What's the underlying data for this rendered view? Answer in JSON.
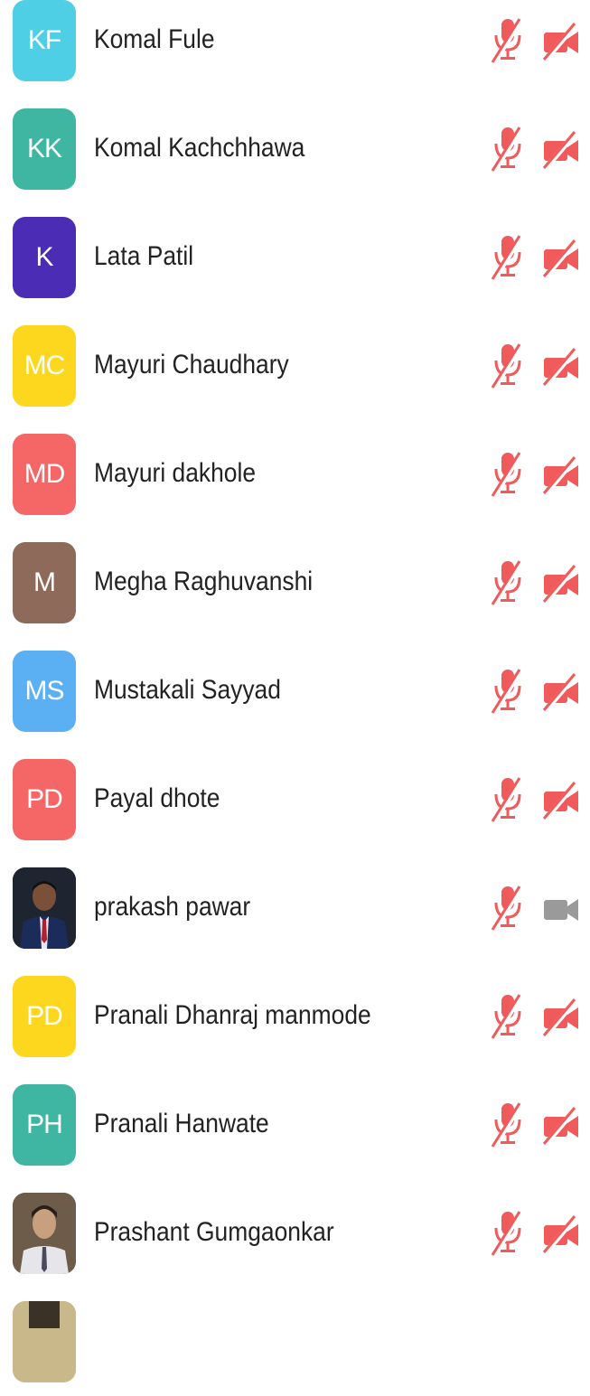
{
  "participants": [
    {
      "name": "Komal Fule",
      "initials": "KF",
      "avatar_color": "#4fcfe6",
      "avatar_type": "initials",
      "mic": "muted",
      "video": "off"
    },
    {
      "name": "Komal Kachchhawa",
      "initials": "KK",
      "avatar_color": "#3fb6a2",
      "avatar_type": "initials",
      "mic": "muted",
      "video": "off"
    },
    {
      "name": "Lata Patil",
      "initials": "K",
      "avatar_color": "#4b2cb4",
      "avatar_type": "initials",
      "mic": "muted",
      "video": "off"
    },
    {
      "name": "Mayuri Chaudhary",
      "initials": "MC",
      "avatar_color": "#fcd71e",
      "avatar_type": "initials",
      "mic": "muted",
      "video": "off"
    },
    {
      "name": "Mayuri dakhole",
      "initials": "MD",
      "avatar_color": "#f56667",
      "avatar_type": "initials",
      "mic": "muted",
      "video": "off"
    },
    {
      "name": "Megha Raghuvanshi",
      "initials": "M",
      "avatar_color": "#8d6a5a",
      "avatar_type": "initials",
      "mic": "muted",
      "video": "off"
    },
    {
      "name": "Mustakali Sayyad",
      "initials": "MS",
      "avatar_color": "#5ab0f2",
      "avatar_type": "initials",
      "mic": "muted",
      "video": "off"
    },
    {
      "name": "Payal dhote",
      "initials": "PD",
      "avatar_color": "#f56667",
      "avatar_type": "initials",
      "mic": "muted",
      "video": "off"
    },
    {
      "name": "prakash pawar",
      "initials": "",
      "avatar_color": "#2a3240",
      "avatar_type": "photo",
      "mic": "muted",
      "video": "on"
    },
    {
      "name": "Pranali Dhanraj manmode",
      "initials": "PD",
      "avatar_color": "#fcd71e",
      "avatar_type": "initials",
      "mic": "muted",
      "video": "off"
    },
    {
      "name": "Pranali Hanwate",
      "initials": "PH",
      "avatar_color": "#3fb6a2",
      "avatar_type": "initials",
      "mic": "muted",
      "video": "off"
    },
    {
      "name": "Prashant Gumgaonkar",
      "initials": "",
      "avatar_color": "#8a7a6a",
      "avatar_type": "photo",
      "mic": "muted",
      "video": "off"
    },
    {
      "name": "",
      "initials": "",
      "avatar_color": "#c9b98a",
      "avatar_type": "photo",
      "mic": "",
      "video": ""
    }
  ],
  "colors": {
    "muted_red": "#f05a5a",
    "video_on_gray": "#9a9a9a",
    "name_text": "#222222",
    "background": "#ffffff"
  },
  "icons": {
    "mic": "microphone-muted-icon",
    "video_off": "video-off-icon",
    "video_on": "video-camera-icon"
  }
}
